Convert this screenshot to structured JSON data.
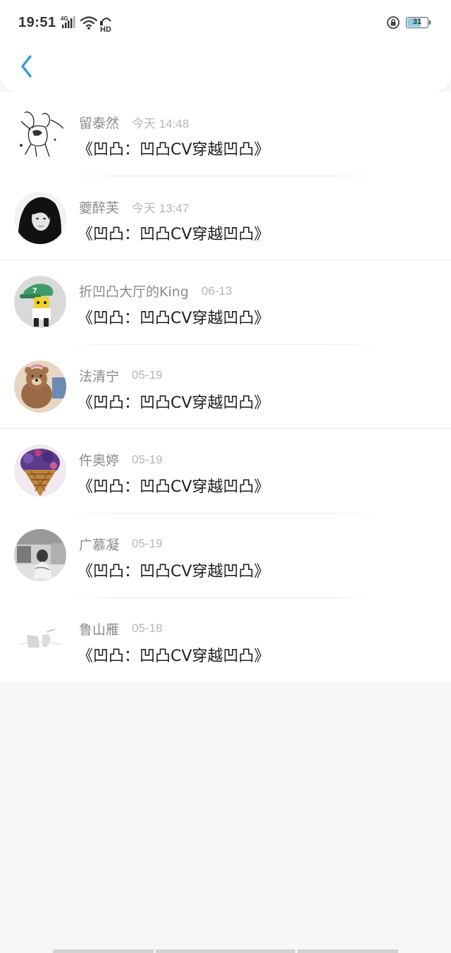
{
  "status_bar": {
    "time": "19:51",
    "network": "4G",
    "hd_label": "HD",
    "battery": "31"
  },
  "header": {
    "back_icon": "chevron-left-icon",
    "accent_color": "#2e97e0"
  },
  "messages": [
    {
      "name": "留泰然",
      "time": "今天 14:48",
      "text": "《凹凸：凹凸CV穿越凹凸》",
      "avatar": "sketch"
    },
    {
      "name": "夔醉芙",
      "time": "今天 13:47",
      "text": "《凹凸：凹凸CV穿越凹凸》",
      "avatar": "girl-bw"
    },
    {
      "name": "折凹凸大厅的King",
      "time": "06-13",
      "text": "《凹凸：凹凸CV穿越凹凸》",
      "avatar": "cartoon-cap"
    },
    {
      "name": "法清宁",
      "time": "05-19",
      "text": "《凹凸：凹凸CV穿越凹凸》",
      "avatar": "bear"
    },
    {
      "name": "仵奥婷",
      "time": "05-19",
      "text": "《凹凸：凹凸CV穿越凹凸》",
      "avatar": "ice-cream"
    },
    {
      "name": "广慕凝",
      "time": "05-19",
      "text": "《凹凸：凹凸CV穿越凹凸》",
      "avatar": "street-bw"
    },
    {
      "name": "鲁山雁",
      "time": "05-18",
      "text": "《凹凸：凹凸CV穿越凹凸》",
      "avatar": "faded"
    }
  ]
}
